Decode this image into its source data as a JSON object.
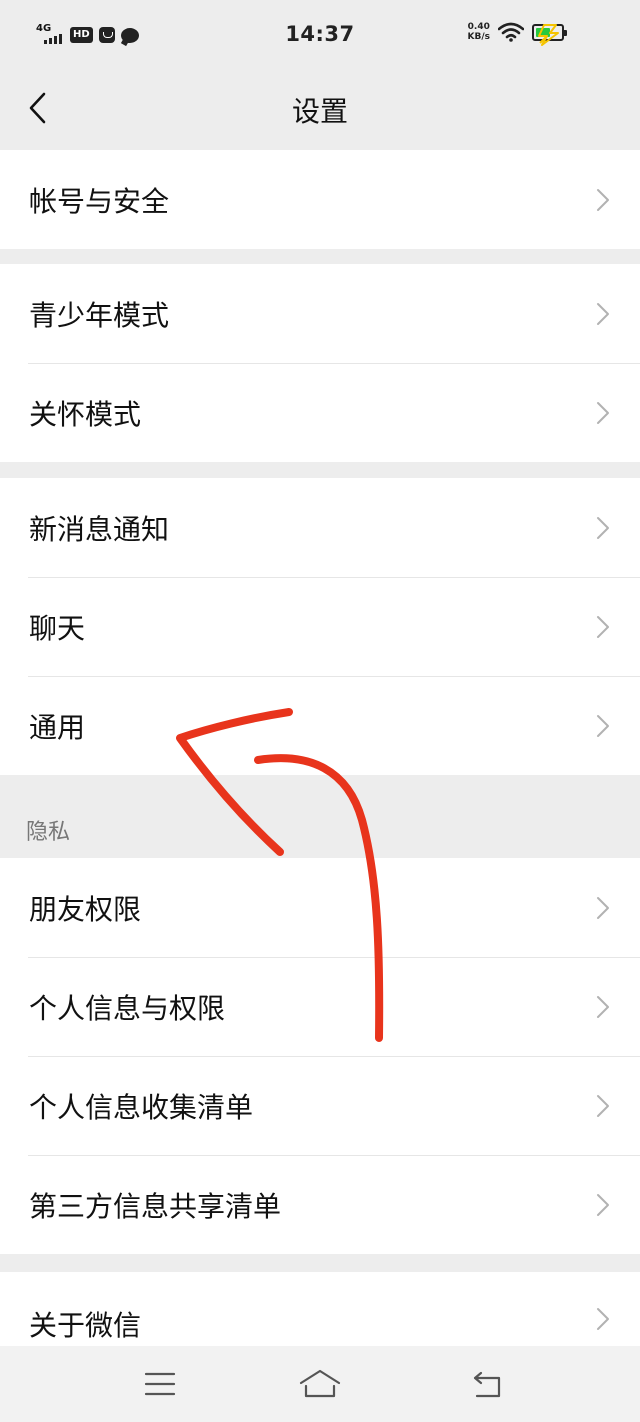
{
  "status_bar": {
    "network": "4G",
    "hd_badge": "HD",
    "time": "14:37",
    "speed_value": "0.40",
    "speed_unit": "KB/s",
    "battery_level": 0.6,
    "battery_color": "#27c93f",
    "charge_color": "#f5c400"
  },
  "header": {
    "title": "设置"
  },
  "groups": [
    {
      "items": [
        {
          "label": "帐号与安全"
        }
      ]
    },
    {
      "items": [
        {
          "label": "青少年模式"
        },
        {
          "label": "关怀模式"
        }
      ]
    },
    {
      "items": [
        {
          "label": "新消息通知"
        },
        {
          "label": "聊天"
        },
        {
          "label": "通用"
        }
      ]
    },
    {
      "header": "隐私",
      "items": [
        {
          "label": "朋友权限"
        },
        {
          "label": "个人信息与权限"
        },
        {
          "label": "个人信息收集清单"
        },
        {
          "label": "第三方信息共享清单"
        }
      ]
    },
    {
      "items": [
        {
          "label": "关于微信"
        }
      ]
    }
  ],
  "icons": {
    "back": "chevron-left-icon",
    "row_arrow": "chevron-right-icon",
    "nav_menu": "menu-icon",
    "nav_home": "home-icon",
    "nav_back": "return-icon"
  },
  "annotation": {
    "color": "#e8341c",
    "description_icon": "red-arrow-annotation"
  }
}
